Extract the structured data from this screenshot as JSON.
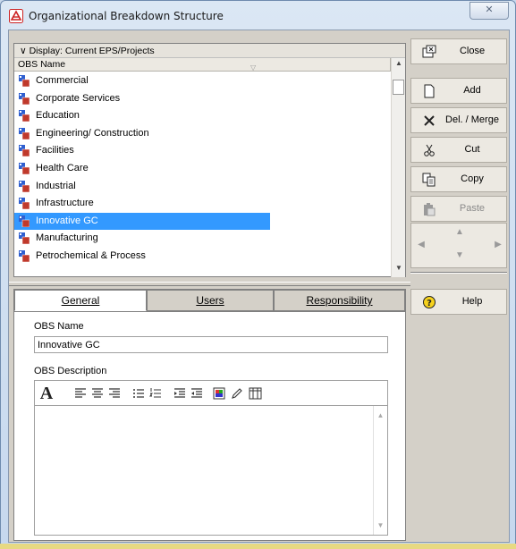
{
  "window": {
    "title": "Organizational Breakdown Structure",
    "close_glyph": "✕"
  },
  "list": {
    "display_label": "∨ Display: Current EPS/Projects",
    "column_header": "OBS Name",
    "sort_glyph": "▽",
    "items": [
      "Commercial",
      "Corporate Services",
      "Education",
      "Engineering/ Construction",
      "Facilities",
      "Health Care",
      "Industrial",
      "Infrastructure",
      "Innovative GC",
      "Manufacturing",
      "Petrochemical & Process"
    ],
    "selected_index": 8
  },
  "tabs": [
    {
      "label": "General",
      "active": true
    },
    {
      "label": "Users",
      "active": false
    },
    {
      "label": "Responsibility",
      "active": false
    }
  ],
  "general": {
    "name_label": "OBS Name",
    "name_value": "Innovative GC",
    "description_label": "OBS Description"
  },
  "editor_toolbar": {
    "font_glyph": "A"
  },
  "commands": {
    "close": "Close",
    "add": "Add",
    "delete_merge": "Del. / Merge",
    "cut": "Cut",
    "copy": "Copy",
    "paste": "Paste",
    "help": "Help"
  },
  "colors": {
    "selection": "#3399ff",
    "obs_icon_blue": "#2f5fd0",
    "obs_icon_red": "#c0392b"
  }
}
